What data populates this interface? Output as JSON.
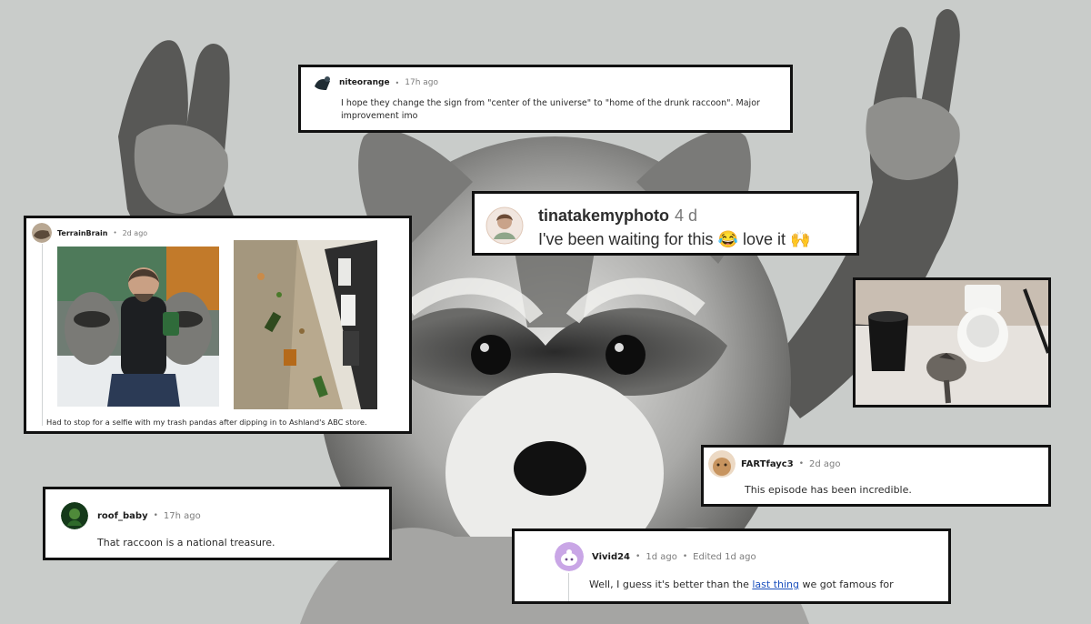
{
  "comments": {
    "niteorange": {
      "username": "niteorange",
      "time": "17h ago",
      "text": "I hope they change the sign from \"center of the universe\" to \"home of the drunk raccoon\". Major improvement imo"
    },
    "tinatakemyphoto": {
      "username": "tinatakemyphoto",
      "time": "4 d",
      "text": "I've been waiting for this 😂 love it 🙌"
    },
    "terrainbrain": {
      "username": "TerrainBrain",
      "time": "2d ago",
      "caption": "Had to stop for a selfie with my trash pandas after dipping in to Ashland's ABC store."
    },
    "fartfayc3": {
      "username": "FARTfayc3",
      "time": "2d ago",
      "text": "This episode has been incredible."
    },
    "roof_baby": {
      "username": "roof_baby",
      "time": "17h ago",
      "text": "That raccoon is a national treasure."
    },
    "vivid24": {
      "username": "Vivid24",
      "time": "1d ago",
      "edited": "Edited 1d ago",
      "text_before": "Well, I guess it's better than the ",
      "link_text": "last thing",
      "text_after": " we got famous for"
    }
  },
  "separator": "•",
  "colors": {
    "background": "#c9ccca",
    "card_border": "#111111",
    "link": "#1a4fbd",
    "meta_gray": "#7c7c7c"
  }
}
